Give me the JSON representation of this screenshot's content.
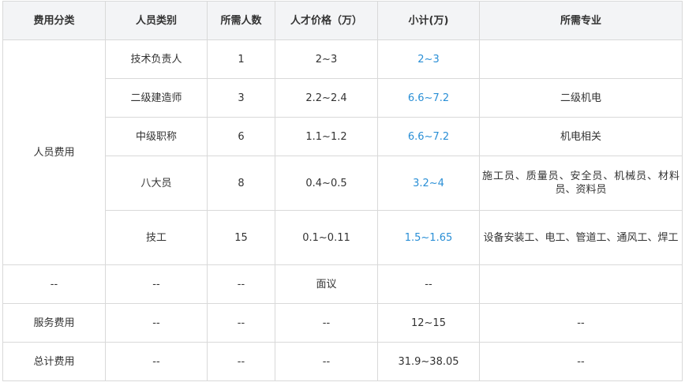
{
  "headers": [
    "费用分类",
    "人员类别",
    "所需人数",
    "人才价格（万）",
    "小计(万)",
    "所需专业"
  ],
  "personnel_category": "人员费用",
  "personnel_rows": [
    {
      "type": "技术负责人",
      "count": "1",
      "price": "2~3",
      "subtotal": "2~3",
      "major": ""
    },
    {
      "type": "二级建造师",
      "count": "3",
      "price": "2.2~2.4",
      "subtotal": "6.6~7.2",
      "major": "二级机电"
    },
    {
      "type": "中级职称",
      "count": "6",
      "price": "1.1~1.2",
      "subtotal": "6.6~7.2",
      "major": "机电相关"
    },
    {
      "type": "八大员",
      "count": "8",
      "price": "0.4~0.5",
      "subtotal": "3.2~4",
      "major": "施工员、质量员、安全员、机械员、材料员、资料员"
    },
    {
      "type": "技工",
      "count": "15",
      "price": "0.1~0.11",
      "subtotal": "1.5~1.65",
      "major": "设备安装工、电工、管道工、通风工、焊工"
    }
  ],
  "other_rows": [
    {
      "category": "--",
      "type": "--",
      "count": "--",
      "price": "面议",
      "subtotal": "--",
      "major": ""
    },
    {
      "category": "服务费用",
      "type": "--",
      "count": "--",
      "price": "--",
      "subtotal": "12~15",
      "major": "--"
    },
    {
      "category": "总计费用",
      "type": "--",
      "count": "--",
      "price": "--",
      "subtotal": "31.9~38.05",
      "major": "--"
    }
  ],
  "colors": {
    "header_bg": "#f3f4f6",
    "border": "#d9d9d9",
    "subtotal_blue": "#2a8fd6",
    "text": "#333333"
  }
}
